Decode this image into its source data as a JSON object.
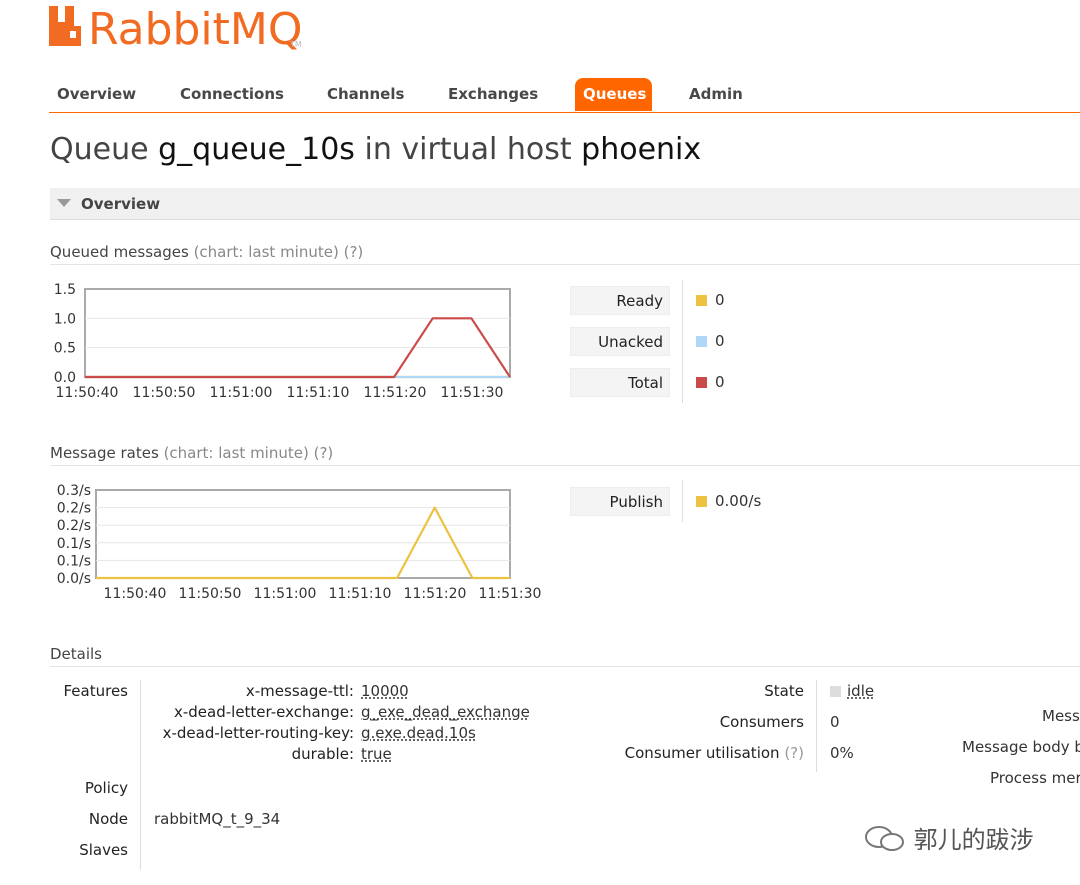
{
  "logo": {
    "text": "RabbitMQ",
    "tm": "TM"
  },
  "nav": {
    "items": [
      "Overview",
      "Connections",
      "Channels",
      "Exchanges",
      "Queues",
      "Admin"
    ],
    "active": "Queues"
  },
  "title": {
    "prefix": "Queue",
    "queue": "g_queue_10s",
    "mid": "in virtual host",
    "vhost": "phoenix"
  },
  "overview_section": {
    "label": "Overview"
  },
  "queued_heading": {
    "label": "Queued messages",
    "hint": "(chart: last minute) (?)"
  },
  "rates_heading": {
    "label": "Message rates",
    "hint": "(chart: last minute) (?)"
  },
  "queued_legend": [
    {
      "label": "Ready",
      "value": "0",
      "color": "#edc240"
    },
    {
      "label": "Unacked",
      "value": "0",
      "color": "#afd8f8"
    },
    {
      "label": "Total",
      "value": "0",
      "color": "#cb4b4b"
    }
  ],
  "rates_legend": [
    {
      "label": "Publish",
      "value": "0.00/s",
      "color": "#edc240"
    }
  ],
  "chart_data": [
    {
      "type": "line",
      "y_ticks": [
        "0.0",
        "0.5",
        "1.0",
        "1.5"
      ],
      "ylim": [
        0,
        1.5
      ],
      "x_ticks": [
        "11:50:40",
        "11:50:50",
        "11:51:00",
        "11:51:10",
        "11:51:20",
        "11:51:30"
      ],
      "xlim": [
        0,
        55
      ],
      "grid": true,
      "series": [
        {
          "name": "Ready",
          "color": "#edc240",
          "x": [
            0,
            55
          ],
          "y": [
            0,
            0
          ]
        },
        {
          "name": "Unacked",
          "color": "#afd8f8",
          "x": [
            0,
            55
          ],
          "y": [
            0,
            0
          ]
        },
        {
          "name": "Total",
          "color": "#cb4b4b",
          "x": [
            0,
            40,
            45,
            50,
            55
          ],
          "y": [
            0,
            0,
            1,
            1,
            0
          ]
        }
      ]
    },
    {
      "type": "line",
      "y_ticks": [
        "0.0/s",
        "0.1/s",
        "0.1/s",
        "0.2/s",
        "0.2/s",
        "0.3/s"
      ],
      "ylim": [
        0,
        0.25
      ],
      "x_ticks": [
        "11:50:40",
        "11:50:50",
        "11:51:00",
        "11:51:10",
        "11:51:20",
        "11:51:30"
      ],
      "xlim": [
        0,
        55
      ],
      "grid": true,
      "series": [
        {
          "name": "Publish",
          "color": "#edc240",
          "x": [
            0,
            40,
            45,
            50,
            55
          ],
          "y": [
            0,
            0,
            0.2,
            0,
            0
          ]
        }
      ]
    }
  ],
  "details": {
    "heading": "Details",
    "features_label": "Features",
    "features": [
      {
        "key": "x-message-ttl:",
        "value": "10000"
      },
      {
        "key": "x-dead-letter-exchange:",
        "value": "g_exe_dead_exchange"
      },
      {
        "key": "x-dead-letter-routing-key:",
        "value": "g.exe.dead.10s"
      },
      {
        "key": "durable:",
        "value": "true"
      }
    ],
    "policy_label": "Policy",
    "node_label": "Node",
    "node_value": "rabbitMQ_t_9_34",
    "slaves_label": "Slaves",
    "state_label": "State",
    "state_value": "idle",
    "consumers_label": "Consumers",
    "consumers_value": "0",
    "utilisation_label": "Consumer utilisation",
    "utilisation_hint": "(?)",
    "utilisation_value": "0%",
    "right_labels": [
      "Mess",
      "Message body b",
      "Process mer"
    ]
  },
  "watermark": {
    "text": "郭儿的跋涉"
  }
}
